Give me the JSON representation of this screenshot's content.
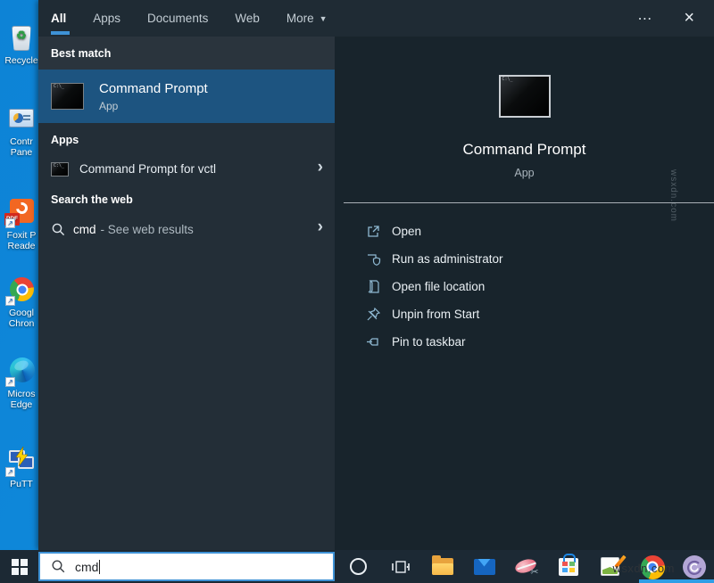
{
  "tabs": {
    "items": [
      {
        "label": "All",
        "selected": true
      },
      {
        "label": "Apps",
        "selected": false
      },
      {
        "label": "Documents",
        "selected": false
      },
      {
        "label": "Web",
        "selected": false
      },
      {
        "label": "More",
        "selected": false
      }
    ],
    "more_arrow": "▼",
    "ellipsis": "⋯",
    "close": "×"
  },
  "results": {
    "best_match_header": "Best match",
    "best_match_title": "Command Prompt",
    "best_match_subtitle": "App",
    "apps_header": "Apps",
    "app_item": "Command Prompt for vctl",
    "web_header": "Search the web",
    "web_query": "cmd",
    "web_suffix": "- See web results",
    "chevron": "›"
  },
  "preview": {
    "title": "Command Prompt",
    "subtitle": "App",
    "actions": [
      {
        "label": "Open"
      },
      {
        "label": "Run as administrator"
      },
      {
        "label": "Open file location"
      },
      {
        "label": "Unpin from Start"
      },
      {
        "label": "Pin to taskbar"
      }
    ]
  },
  "desktop": {
    "icons": [
      {
        "id": "recycle-bin",
        "line1": "Recycle",
        "line2": ""
      },
      {
        "id": "control-panel",
        "line1": "Contr",
        "line2": "Pane"
      },
      {
        "id": "foxit-reader",
        "line1": "Foxit P",
        "line2": "Reade"
      },
      {
        "id": "google-chrome",
        "line1": "Googl",
        "line2": "Chron"
      },
      {
        "id": "microsoft-edge",
        "line1": "Micros",
        "line2": "Edge"
      },
      {
        "id": "putty",
        "line1": "PuTT",
        "line2": ""
      }
    ]
  },
  "taskbar": {
    "search_value": "cmd"
  },
  "watermark": {
    "text": "wsxdn.com"
  },
  "colors": {
    "accent": "#3e92d6",
    "highlight": "#1d5480",
    "desktop_blue": "#0f86d9",
    "flyout_bg": "#232e37",
    "preview_bg": "#18242c",
    "taskbar_bg": "#1c2934"
  }
}
